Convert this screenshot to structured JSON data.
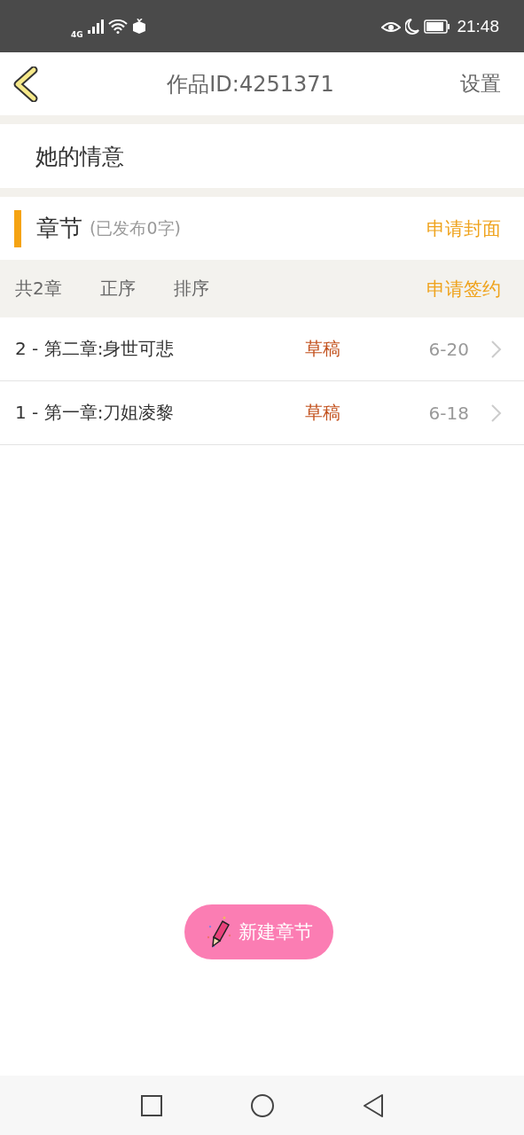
{
  "status_bar": {
    "network": "4G",
    "time": "21:48"
  },
  "header": {
    "title": "作品ID:4251371",
    "action": "设置"
  },
  "work_title": "她的情意",
  "section": {
    "title": "章节",
    "subtitle": "(已发布0字)",
    "action": "申请封面"
  },
  "toolbar": {
    "count": "共2章",
    "order": "正序",
    "sort": "排序",
    "action": "申请签约"
  },
  "chapters": [
    {
      "title": "2 - 第二章:身世可悲",
      "status": "草稿",
      "date": "6-20"
    },
    {
      "title": "1 - 第一章:刀姐凌黎",
      "status": "草稿",
      "date": "6-18"
    }
  ],
  "new_button": "新建章节"
}
